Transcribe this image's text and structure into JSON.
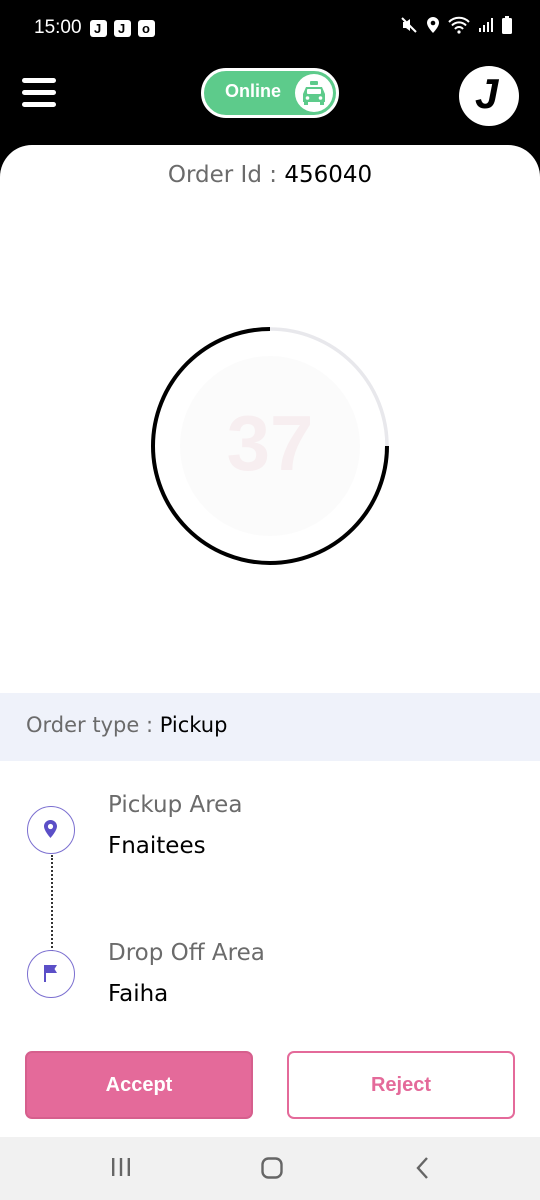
{
  "status_bar": {
    "time": "15:00",
    "app_icons": [
      "J",
      "J",
      "o"
    ],
    "right_icons": [
      "mute-icon",
      "location-icon",
      "wifi-icon",
      "signal-icon",
      "battery-icon"
    ]
  },
  "header": {
    "status_toggle_label": "Online",
    "avatar_letter": "J"
  },
  "order": {
    "id_label": "Order Id : ",
    "id_value": "456040",
    "timer_value": "37",
    "type_label": "Order type : ",
    "type_value": "Pickup"
  },
  "route": {
    "pickup_label": "Pickup Area",
    "pickup_value": "Fnaitees",
    "dropoff_label": "Drop Off Area",
    "dropoff_value": "Faiha"
  },
  "actions": {
    "accept_label": "Accept",
    "reject_label": "Reject"
  },
  "colors": {
    "online_green": "#5dcb8b",
    "accent_pink": "#e46a9a",
    "route_icon_purple": "#5b4fc7",
    "order_type_bg": "#eff2fa"
  }
}
